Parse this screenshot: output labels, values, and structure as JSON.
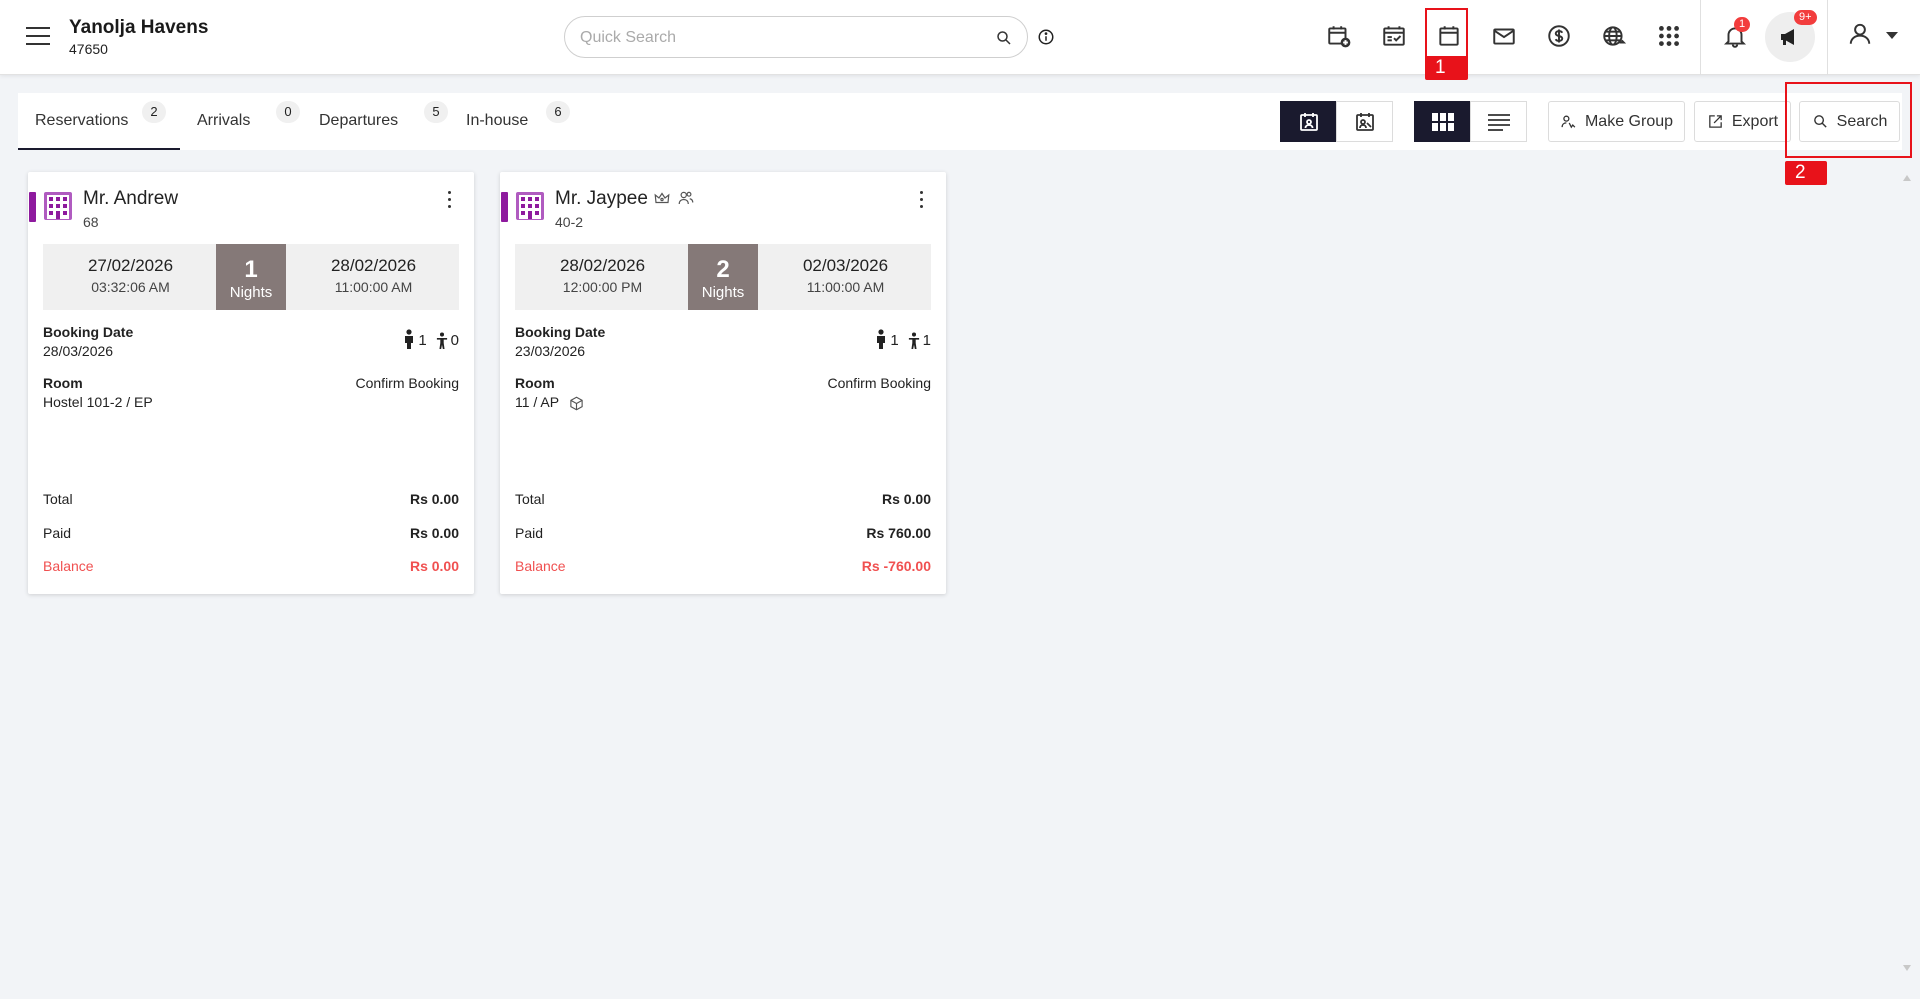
{
  "header": {
    "hotel_name": "Yanolja Havens",
    "hotel_id": "47650",
    "search_placeholder": "Quick Search",
    "notification_count": "1",
    "announcement_count": "9+"
  },
  "annotations": {
    "box1_label": "1",
    "box2_label": "2",
    "color": "#e8121a"
  },
  "tabs": [
    {
      "label": "Reservations",
      "count": "2"
    },
    {
      "label": "Arrivals",
      "count": "0"
    },
    {
      "label": "Departures",
      "count": "5"
    },
    {
      "label": "In-house",
      "count": "6"
    }
  ],
  "toolbar": {
    "make_group_label": "Make Group",
    "export_label": "Export",
    "search_label": "Search"
  },
  "cards": [
    {
      "guest_name": "Mr. Andrew",
      "reservation_id": "68",
      "checkin_date": "27/02/2026",
      "checkin_time": "03:32:06 AM",
      "nights": "1",
      "nights_label": "Nights",
      "checkout_date": "28/02/2026",
      "checkout_time": "11:00:00 AM",
      "booking_date_label": "Booking Date",
      "booking_date": "28/03/2026",
      "adults": "1",
      "children": "0",
      "room_label": "Room",
      "room": "Hostel 101-2 / EP",
      "status": "Confirm Booking",
      "total_label": "Total",
      "total": "Rs 0.00",
      "paid_label": "Paid",
      "paid": "Rs 0.00",
      "balance_label": "Balance",
      "balance": "Rs 0.00"
    },
    {
      "guest_name": "Mr. Jaypee",
      "reservation_id": "40-2",
      "checkin_date": "28/02/2026",
      "checkin_time": "12:00:00 PM",
      "nights": "2",
      "nights_label": "Nights",
      "checkout_date": "02/03/2026",
      "checkout_time": "11:00:00 AM",
      "booking_date_label": "Booking Date",
      "booking_date": "23/03/2026",
      "adults": "1",
      "children": "1",
      "room_label": "Room",
      "room": "11 / AP",
      "status": "Confirm Booking",
      "total_label": "Total",
      "total": "Rs 0.00",
      "paid_label": "Paid",
      "paid": "Rs 760.00",
      "balance_label": "Balance",
      "balance": "Rs -760.00"
    }
  ],
  "colors": {
    "accent_dark": "#1a1a2e",
    "card_accent": "#8e1a9e",
    "nights_bg": "#857978",
    "balance_red": "#f05050",
    "badge_red": "#f23d3d"
  }
}
